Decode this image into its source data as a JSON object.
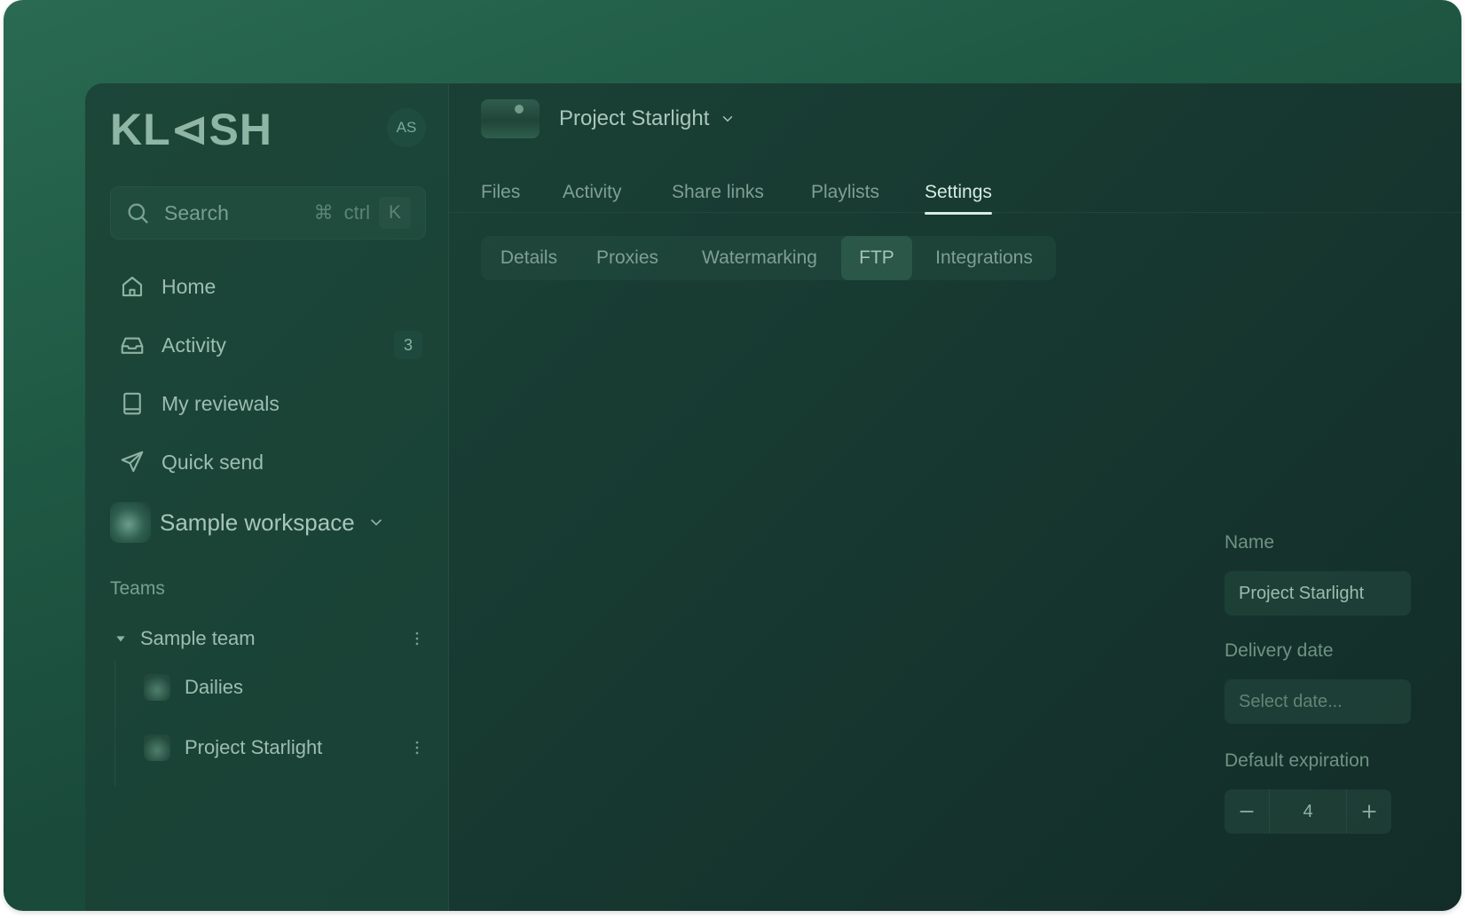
{
  "sidebar": {
    "logo": "KL⊲SH",
    "avatar": "AS",
    "search": {
      "placeholder": "Search",
      "shortcut_cmd": "⌘",
      "shortcut_ctrl": "ctrl",
      "shortcut_key": "K"
    },
    "nav": [
      {
        "label": "Home",
        "icon": "home-icon"
      },
      {
        "label": "Activity",
        "icon": "inbox-icon",
        "badge": "3"
      },
      {
        "label": "My reviewals",
        "icon": "book-icon"
      },
      {
        "label": "Quick send",
        "icon": "send-icon"
      }
    ],
    "workspace": {
      "name": "Sample workspace"
    },
    "teams_label": "Teams",
    "team": {
      "name": "Sample team",
      "items": [
        {
          "label": "Dailies"
        },
        {
          "label": "Project Starlight"
        }
      ]
    }
  },
  "header": {
    "project_title": "Project Starlight"
  },
  "tabs": [
    {
      "label": "Files"
    },
    {
      "label": "Activity"
    },
    {
      "label": "Share links"
    },
    {
      "label": "Playlists"
    },
    {
      "label": "Settings",
      "active": true
    }
  ],
  "subtabs": [
    {
      "label": "Details"
    },
    {
      "label": "Proxies"
    },
    {
      "label": "Watermarking"
    },
    {
      "label": "FTP",
      "active": true
    },
    {
      "label": "Integrations"
    }
  ],
  "form": {
    "name_label": "Name",
    "name_value": "Project Starlight",
    "delivery_label": "Delivery date",
    "delivery_placeholder": "Select date...",
    "expiration_label": "Default expiration",
    "expiration_value": "4"
  },
  "colors": {
    "accent_bg": "#1f5a45",
    "active_text": "#d8ebe2"
  }
}
